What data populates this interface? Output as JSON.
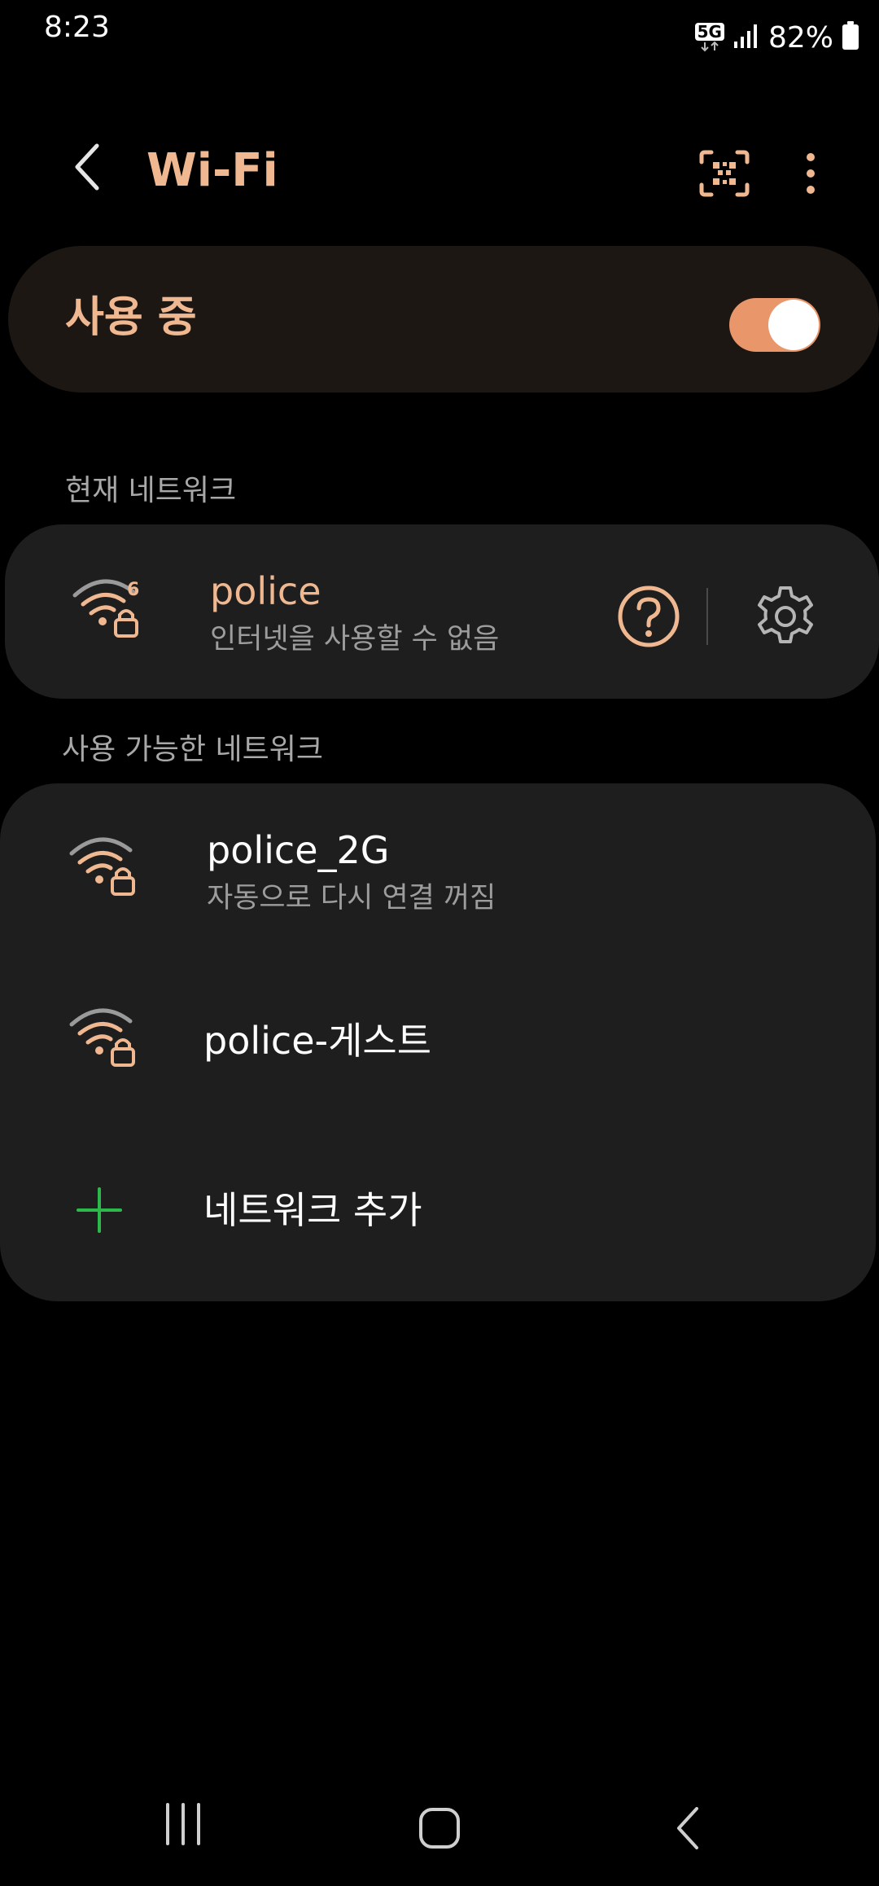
{
  "status_bar": {
    "time": "8:23",
    "network_badge": "5G",
    "battery": "82%"
  },
  "header": {
    "title": "Wi-Fi",
    "back_icon": "back-chevron-icon",
    "qr_icon": "qr-code-icon",
    "more_icon": "more-vert-icon"
  },
  "master_switch": {
    "label": "사용 중",
    "on": true
  },
  "current_section": {
    "label": "현재 네트워크",
    "network": {
      "name": "police",
      "status": "인터넷을 사용할 수 없음",
      "badge": "6",
      "icon": "wifi-lock-icon"
    }
  },
  "available_section": {
    "label": "사용 가능한 네트워크",
    "networks": [
      {
        "name": "police_2G",
        "status": "자동으로 다시 연결 꺼짐",
        "icon": "wifi-lock-icon"
      },
      {
        "name": "police-게스트",
        "status": "",
        "icon": "wifi-lock-icon"
      }
    ],
    "add_label": "네트워크 추가"
  },
  "colors": {
    "accent": "#f0b891",
    "toggle": "#e8966a",
    "add_plus": "#2db84b",
    "card": "#1e1e1e",
    "background": "#000000"
  }
}
